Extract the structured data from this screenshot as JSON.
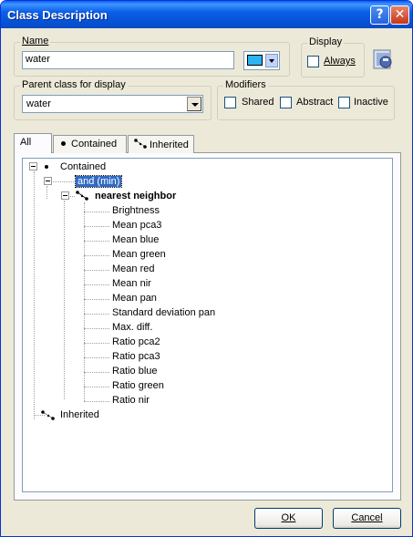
{
  "window": {
    "title": "Class Description"
  },
  "name_group": {
    "legend": "Name",
    "value": "water",
    "color": "#2BB3F2"
  },
  "display_group": {
    "legend": "Display",
    "always_label": "Always",
    "always_checked": false
  },
  "parent_group": {
    "legend": "Parent class for display",
    "value": "water"
  },
  "modifiers_group": {
    "legend": "Modifiers",
    "shared_label": "Shared",
    "abstract_label": "Abstract",
    "inactive_label": "Inactive"
  },
  "tabs": [
    {
      "label": "All",
      "active": true
    },
    {
      "label": "Contained",
      "active": false
    },
    {
      "label": "Inherited",
      "active": false
    }
  ],
  "tree": {
    "root_contained": "Contained",
    "operator": "and (min)",
    "expression": "nearest neighbor",
    "features": [
      "Brightness",
      "Mean pca3",
      "Mean blue",
      "Mean green",
      "Mean red",
      "Mean nir",
      "Mean pan",
      "Standard deviation pan",
      "Max. diff.",
      "Ratio pca2",
      "Ratio pca3",
      "Ratio blue",
      "Ratio green",
      "Ratio nir"
    ],
    "root_inherited": "Inherited"
  },
  "buttons": {
    "ok": "OK",
    "cancel": "Cancel"
  }
}
